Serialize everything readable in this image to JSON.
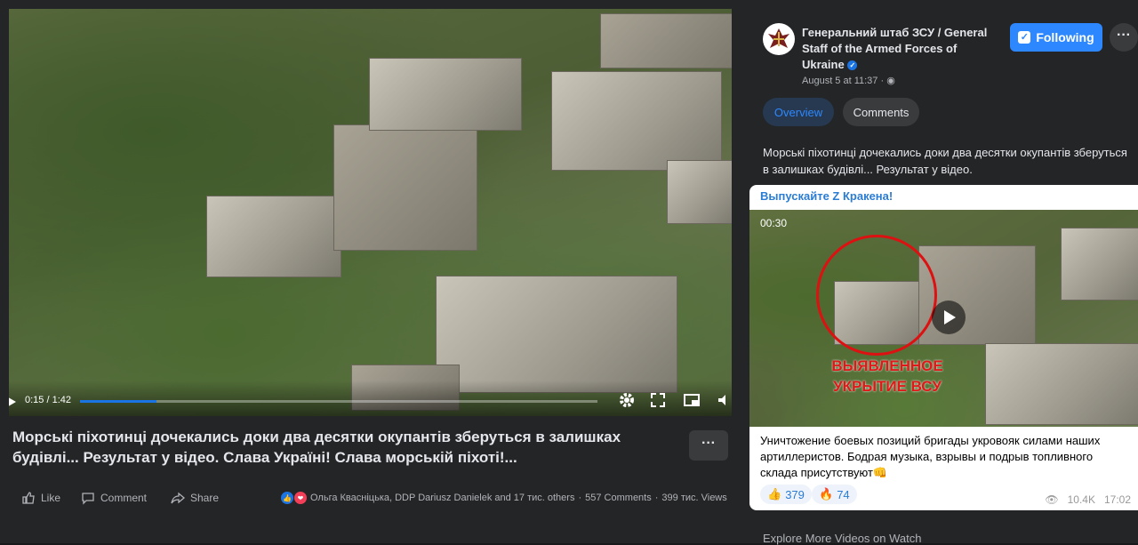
{
  "video": {
    "time": "0:15 / 1:42",
    "progress": 0.147,
    "title": "Морські піхотинці дочекались доки два десятки окупантів зберуться в залишках будівлі... Результат у відео. Слава Україні! Слава морській піхоті!..."
  },
  "actions": {
    "like": "Like",
    "comment": "Comment",
    "share": "Share",
    "reactions_summary": "Ольга Квасніцька, DDP Dariusz Danielek and 17 тис. others",
    "comments_count": "557 Comments",
    "views_count": "399 тис. Views",
    "more": "···"
  },
  "page": {
    "name": "Генеральний штаб ЗСУ / General Staff of the Armed Forces of Ukraine",
    "date": "August 5 at 11:37 · ",
    "follow_label": "Following",
    "more": "···"
  },
  "tabs": [
    {
      "label": "Overview",
      "active": true
    },
    {
      "label": "Comments",
      "active": false
    }
  ],
  "description": "Морські піхотинці дочекались доки два десятки окупантів зберуться в залишках будівлі... Результат у відео.",
  "card": {
    "header": "Выпускайте Z Кракена!",
    "video_time": "00:30",
    "overlay_text": "ВЫЯВЛЕННОЕ УКРЫТИЕ ВСУ",
    "text": "Уничтожение боевых позиций бригады укровояк силами наших артиллеристов. Бодрая музыка, взрывы и подрыв топливного склада присутствуют👊",
    "reaction_like": "379",
    "reaction_fire": "74",
    "views": "10.4K",
    "time": "17:02"
  },
  "colors": {
    "accent": "#2d88ff",
    "background": "#242526",
    "card_link": "#2b7cd3",
    "overlay_red": "#e01818"
  },
  "bottom_hint": "Explore More Videos on Watch"
}
